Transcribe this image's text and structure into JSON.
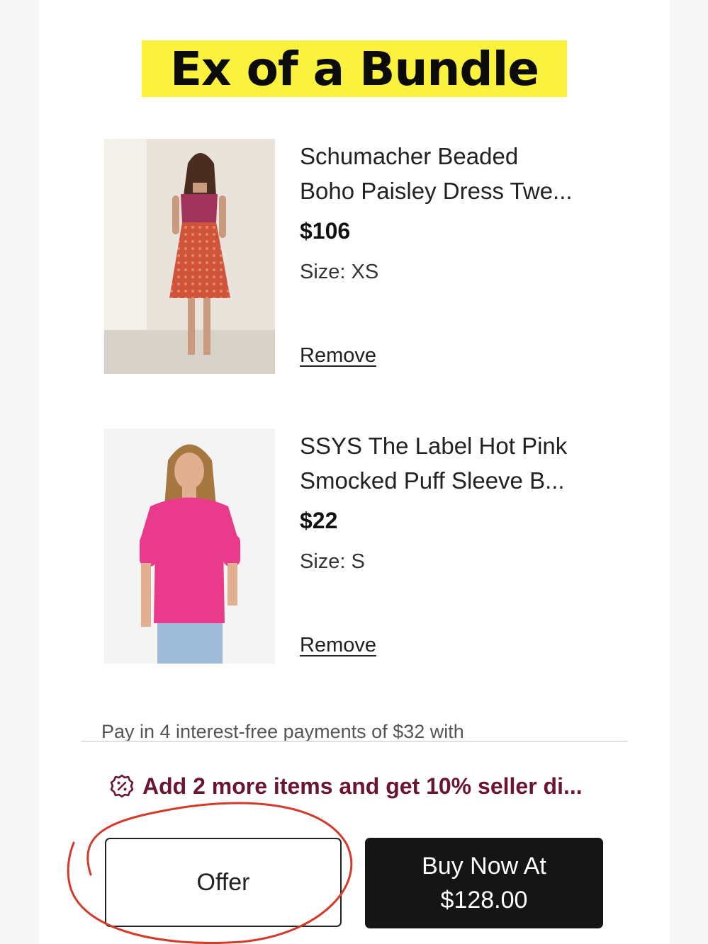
{
  "title_banner": "Ex of a Bundle",
  "items": [
    {
      "name_line1": "Schumacher Beaded",
      "name_line2": "Boho Paisley Dress Twe...",
      "price": "$106",
      "size": "Size: XS",
      "remove_label": "Remove",
      "image_icon": "boho-dress-photo"
    },
    {
      "name_line1": "SSYS The Label Hot Pink",
      "name_line2": "Smocked Puff Sleeve B...",
      "price": "$22",
      "size": "Size: S",
      "remove_label": "Remove",
      "image_icon": "pink-blouse-photo"
    }
  ],
  "installments_text": "Pay in 4 interest-free payments of $32 with",
  "promo": {
    "text": "Add 2 more items and get 10% seller di...",
    "icon": "discount-badge-icon",
    "color": "#6b1532"
  },
  "actions": {
    "offer_label": "Offer",
    "buy_line1": "Buy Now At",
    "buy_line2": "$128.00"
  },
  "colors": {
    "banner": "#fbf23e",
    "annotation_circle": "#d23a2a",
    "buy_button": "#151515"
  }
}
